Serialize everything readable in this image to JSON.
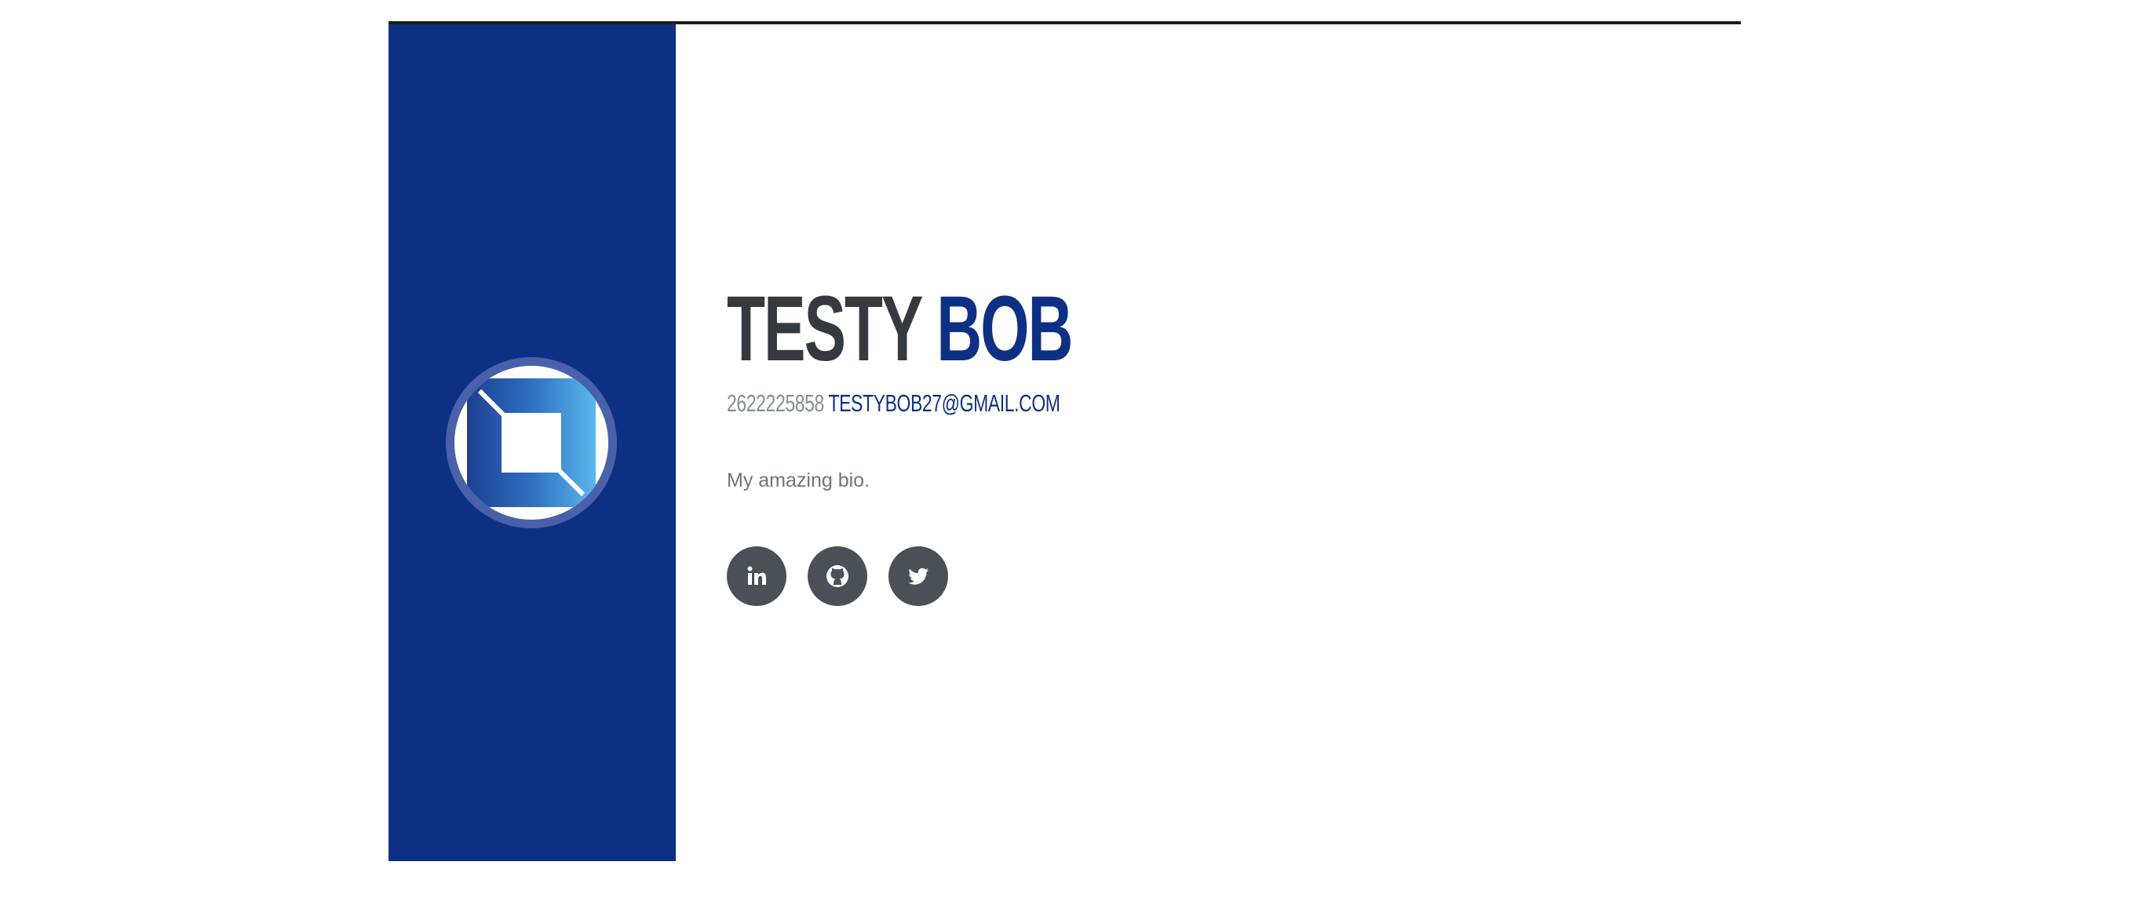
{
  "profile": {
    "first_name": "TESTY",
    "last_name": "BOB",
    "phone": "2622225858",
    "email": "TESTYBOB27@GMAIL.COM",
    "bio": "My amazing bio."
  },
  "avatar": {
    "icon": "logo-icon"
  },
  "socials": [
    {
      "name": "linkedin",
      "icon": "linkedin-icon"
    },
    {
      "name": "github",
      "icon": "github-icon"
    },
    {
      "name": "twitter",
      "icon": "twitter-icon"
    }
  ],
  "colors": {
    "primary": "#0e3084",
    "heading": "#343a40",
    "muted": "#868e96",
    "bio_text": "#6c757d",
    "social_bg": "#495057"
  }
}
